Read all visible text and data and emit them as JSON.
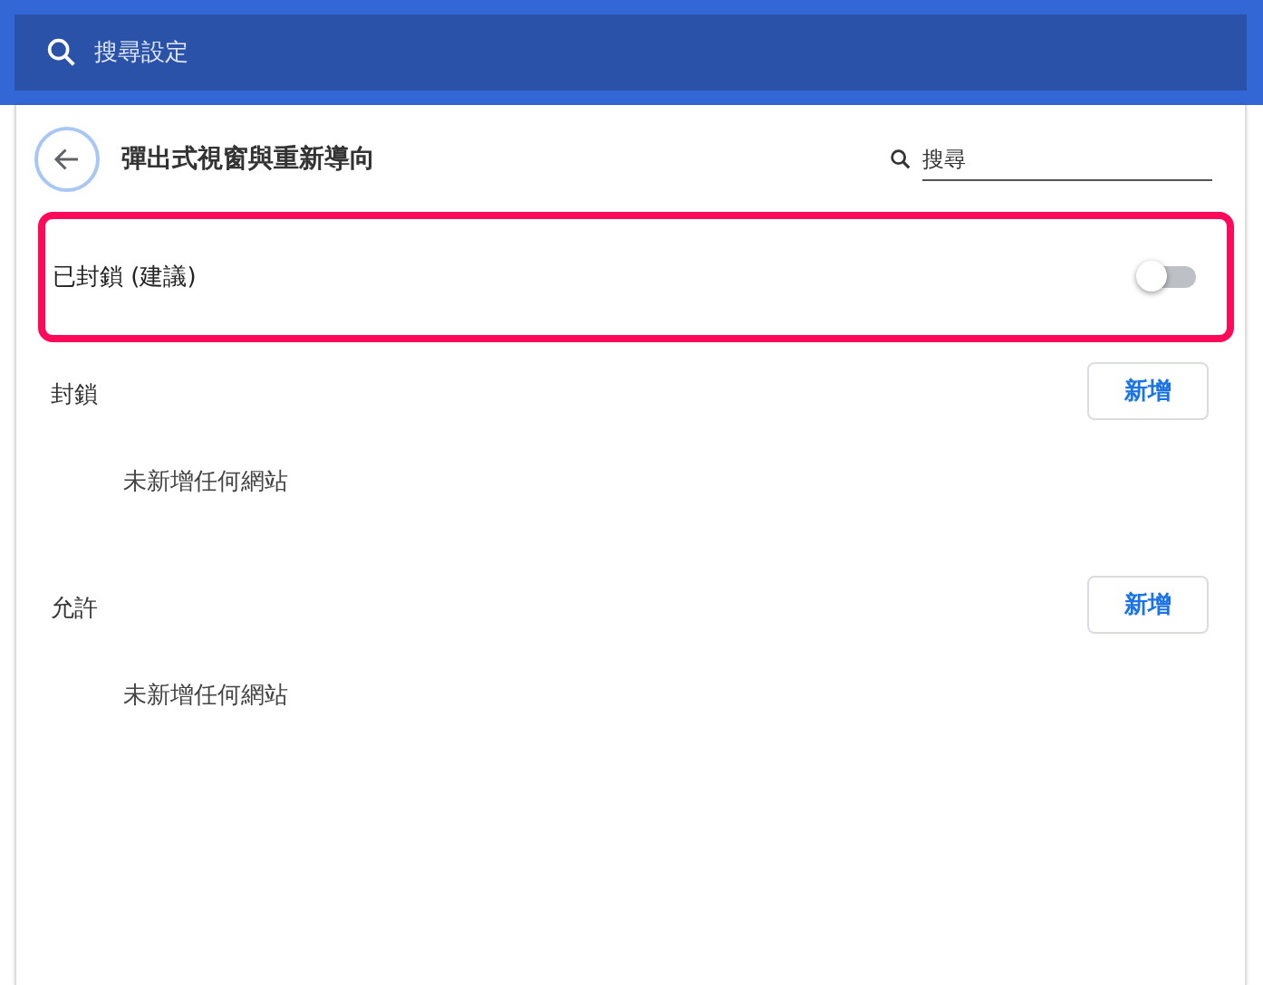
{
  "top_search": {
    "placeholder": "搜尋設定"
  },
  "page": {
    "title": "彈出式視窗與重新導向",
    "search": {
      "placeholder": "搜尋"
    }
  },
  "setting": {
    "label": "已封鎖 (建議)",
    "on": false,
    "highlighted": true
  },
  "sections": [
    {
      "title": "封鎖",
      "button": "新增",
      "empty_text": "未新增任何網站"
    },
    {
      "title": "允許",
      "button": "新增",
      "empty_text": "未新增任何網站"
    }
  ]
}
